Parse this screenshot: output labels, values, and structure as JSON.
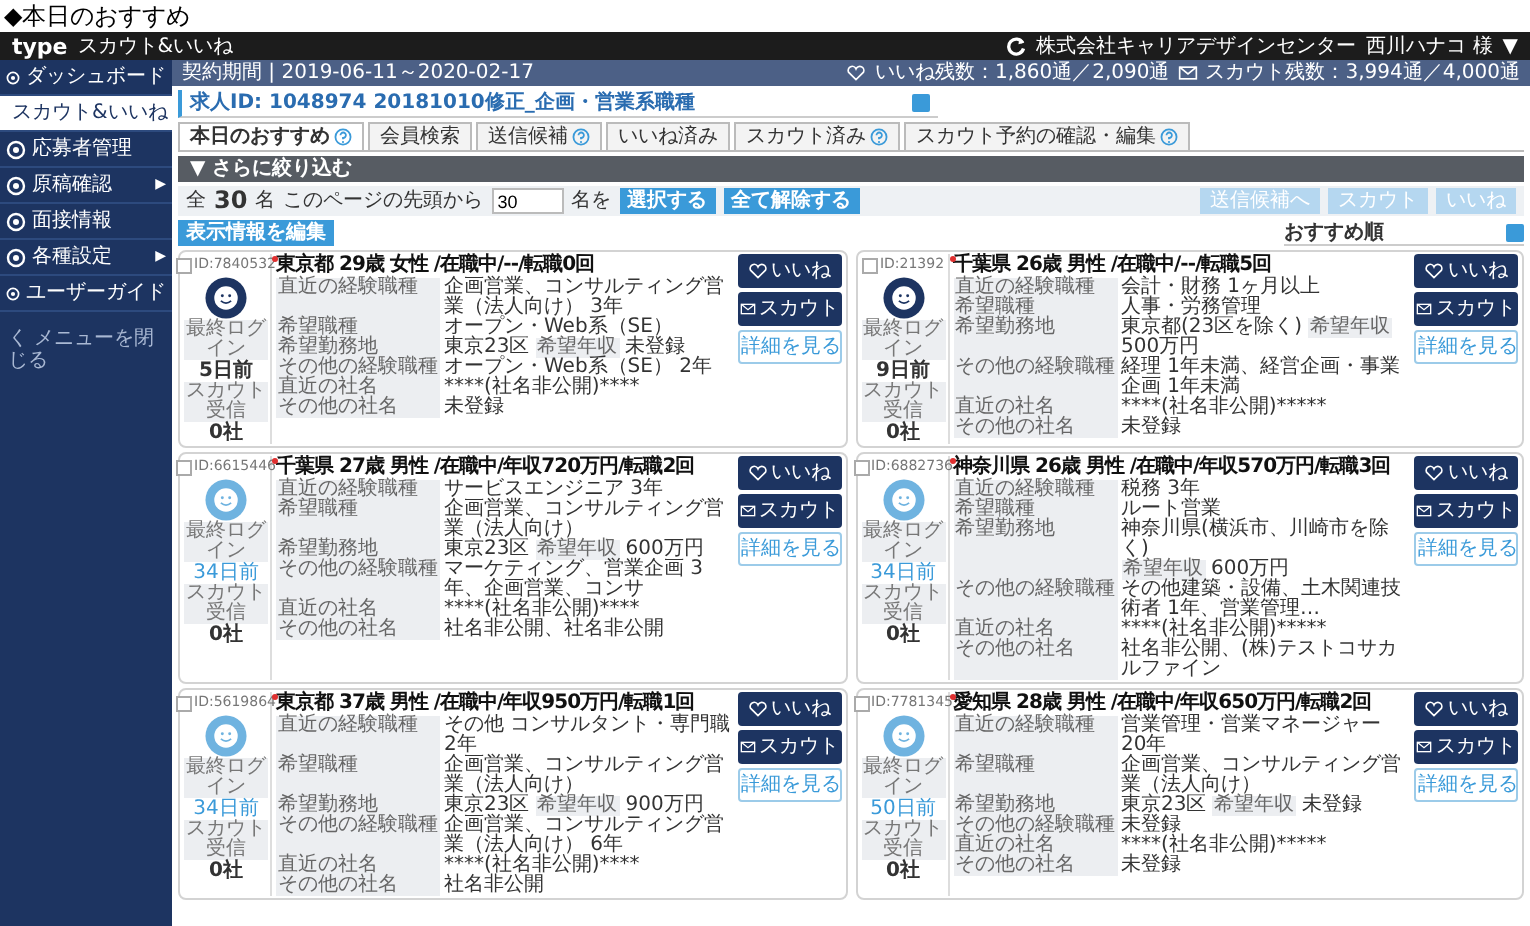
{
  "page_heading": "◆本日のおすすめ",
  "header": {
    "logo": "type",
    "product": "スカウト&いいね",
    "company": "株式会社キャリアデザインセンター",
    "user": "西川ハナコ 様",
    "user_caret": "▼"
  },
  "sidebar": {
    "items": [
      {
        "label": "ダッシュボード",
        "selected": false
      },
      {
        "label": "スカウト&いいね",
        "selected": true
      },
      {
        "label": "応募者管理",
        "selected": false
      },
      {
        "label": "原稿確認",
        "selected": false,
        "arrow": "▶"
      },
      {
        "label": "面接情報",
        "selected": false
      },
      {
        "label": "各種設定",
        "selected": false,
        "arrow": "▶"
      },
      {
        "label": "ユーザーガイド",
        "selected": false
      }
    ],
    "close_menu": "く メニューを閉じる"
  },
  "info_bar": {
    "contract": "契約期間 | 2019-06-11～2020-02-17",
    "likes_left": "いいね残数：1,860通／2,090通",
    "scouts_left": "スカウト残数：3,994通／4,000通"
  },
  "job_select": {
    "value": "求人ID: 1048974 20181010修正_企画・営業系職種"
  },
  "tabs": [
    {
      "label": "本日のおすすめ",
      "selected": true,
      "help": true
    },
    {
      "label": "会員検索",
      "selected": false,
      "help": false
    },
    {
      "label": "送信候補",
      "selected": false,
      "help": true
    },
    {
      "label": "いいね済み",
      "selected": false,
      "help": false
    },
    {
      "label": "スカウト済み",
      "selected": false,
      "help": true
    },
    {
      "label": "スカウト予約の確認・編集",
      "selected": false,
      "help": true
    }
  ],
  "filter_bar": {
    "label": "▼ さらに絞り込む"
  },
  "selection": {
    "prefix": "全",
    "count": "30",
    "suffix": "名",
    "range_label": "このページの先頭から",
    "range_value": "30",
    "range_suffix": "名を",
    "select_button": "選択する",
    "clear_button": "全て解除する",
    "bulk_buttons": [
      {
        "label": "送信候補へ",
        "disabled": true
      },
      {
        "label": "スカウト",
        "disabled": true
      },
      {
        "label": "いいね",
        "disabled": true
      }
    ]
  },
  "edit_button": "表示情報を編集",
  "sort": {
    "value": "おすすめ順"
  },
  "candidates": [
    {
      "id": "ID:7840532",
      "new": true,
      "checked": false,
      "recent_login": true,
      "login_label": "最終ログイン",
      "login": "5日前",
      "scout_label": "スカウト受信",
      "scout": "0社",
      "title": "東京都 29歳 女性 /在職中/--/転職0回",
      "like": "いいね",
      "scout_button": "スカウト",
      "detail": "詳細を見る",
      "rows": [
        {
          "label": "直近の経験職種",
          "value": "企画営業、コンサルティング営業（法人向け） 3年"
        },
        {
          "label": "希望職種",
          "value": "オープン・Web系（SE）"
        },
        {
          "label": "希望勤務地",
          "value": "東京23区",
          "label2": "希望年収",
          "value2": "未登録"
        },
        {
          "label": "その他の経験職種",
          "value": "オープン・Web系（SE） 2年"
        },
        {
          "label": "直近の社名",
          "value": "****(社名非公開)****"
        },
        {
          "label": "その他の社名",
          "value": "未登録"
        }
      ]
    },
    {
      "id": "ID:21392",
      "new": true,
      "checked": false,
      "recent_login": true,
      "login_label": "最終ログイン",
      "login": "9日前",
      "scout_label": "スカウト受信",
      "scout": "0社",
      "title": "千葉県 26歳 男性 /在職中/--/転職5回",
      "like": "いいね",
      "scout_button": "スカウト",
      "detail": "詳細を見る",
      "rows": [
        {
          "label": "直近の経験職種",
          "value": "会計・財務 1ヶ月以上"
        },
        {
          "label": "希望職種",
          "value": "人事・労務管理"
        },
        {
          "label": "希望勤務地",
          "value": "東京都(23区を除く)",
          "label2": "希望年収",
          "value2": "500万円"
        },
        {
          "label": "その他の経験職種",
          "value": "経理 1年未満、経営企画・事業企画 1年未満"
        },
        {
          "label": "直近の社名",
          "value": "****(社名非公開)*****"
        },
        {
          "label": "その他の社名",
          "value": "未登録"
        }
      ]
    },
    {
      "id": "ID:6615446",
      "new": true,
      "checked": false,
      "recent_login": false,
      "login_label": "最終ログイン",
      "login": "34日前",
      "scout_label": "スカウト受信",
      "scout": "0社",
      "title": "千葉県 27歳 男性 /在職中/年収720万円/転職2回",
      "like": "いいね",
      "scout_button": "スカウト",
      "detail": "詳細を見る",
      "rows": [
        {
          "label": "直近の経験職種",
          "value": "サービスエンジニア 3年"
        },
        {
          "label": "希望職種",
          "value": "企画営業、コンサルティング営業（法人向け）"
        },
        {
          "label": "希望勤務地",
          "value": "東京23区",
          "label2": "希望年収",
          "value2": "600万円"
        },
        {
          "label": "その他の経験職種",
          "value": "マーケティング、営業企画 3年、企画営業、コンサ"
        },
        {
          "label": "直近の社名",
          "value": "****(社名非公開)****"
        },
        {
          "label": "その他の社名",
          "value": "社名非公開、社名非公開"
        }
      ]
    },
    {
      "id": "ID:6882736",
      "new": true,
      "checked": false,
      "recent_login": false,
      "login_label": "最終ログイン",
      "login": "34日前",
      "scout_label": "スカウト受信",
      "scout": "0社",
      "title": "神奈川県 26歳 男性 /在職中/年収570万円/転職3回",
      "like": "いいね",
      "scout_button": "スカウト",
      "detail": "詳細を見る",
      "rows": [
        {
          "label": "直近の経験職種",
          "value": "税務 3年"
        },
        {
          "label": "希望職種",
          "value": "ルート営業"
        },
        {
          "label": "希望勤務地",
          "value": "神奈川県(横浜市、川崎市を除く)",
          "label2": "希望年収",
          "value2": "600万円"
        },
        {
          "label": "その他の経験職種",
          "value": "その他建築・設備、土木関連技術者 1年、営業管理…"
        },
        {
          "label": "直近の社名",
          "value": "****(社名非公開)*****"
        },
        {
          "label": "その他の社名",
          "value": "社名非公開、(株)テストコサカルファイン"
        }
      ]
    },
    {
      "id": "ID:5619864",
      "new": true,
      "checked": false,
      "recent_login": false,
      "login_label": "最終ログイン",
      "login": "34日前",
      "scout_label": "スカウト受信",
      "scout": "0社",
      "title": "東京都 37歳 男性 /在職中/年収950万円/転職1回",
      "like": "いいね",
      "scout_button": "スカウト",
      "detail": "詳細を見る",
      "rows": [
        {
          "label": "直近の経験職種",
          "value": "その他 コンサルタント・専門職 2年"
        },
        {
          "label": "希望職種",
          "value": "企画営業、コンサルティング営業（法人向け）"
        },
        {
          "label": "希望勤務地",
          "value": "東京23区",
          "label2": "希望年収",
          "value2": "900万円"
        },
        {
          "label": "その他の経験職種",
          "value": "企画営業、コンサルティング営業（法人向け） 6年"
        },
        {
          "label": "直近の社名",
          "value": "****(社名非公開)****"
        },
        {
          "label": "その他の社名",
          "value": "社名非公開"
        }
      ]
    },
    {
      "id": "ID:7781345",
      "new": true,
      "checked": false,
      "recent_login": false,
      "login_label": "最終ログイン",
      "login": "50日前",
      "scout_label": "スカウト受信",
      "scout": "0社",
      "title": "愛知県 28歳 男性 /在職中/年収650万円/転職2回",
      "like": "いいね",
      "scout_button": "スカウト",
      "detail": "詳細を見る",
      "rows": [
        {
          "label": "直近の経験職種",
          "value": "営業管理・営業マネージャー 20年"
        },
        {
          "label": "希望職種",
          "value": "企画営業、コンサルティング営業（法人向け）"
        },
        {
          "label": "希望勤務地",
          "value": "東京23区",
          "label2": "希望年収",
          "value2": "未登録"
        },
        {
          "label": "その他の経験職種",
          "value": "未登録"
        },
        {
          "label": "直近の社名",
          "value": "****(社名非公開)*****"
        },
        {
          "label": "その他の社名",
          "value": "未登録"
        }
      ]
    }
  ]
}
